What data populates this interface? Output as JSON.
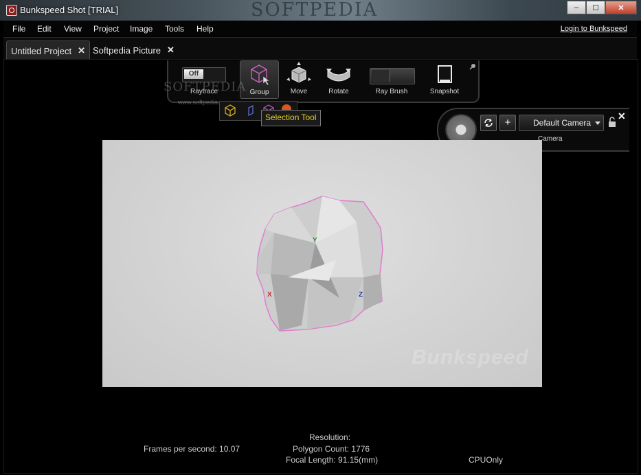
{
  "window": {
    "title": "Bunkspeed Shot [TRIAL]",
    "watermark": "SOFTPEDIA",
    "controls": {
      "minimize": "–",
      "maximize": "☐",
      "close": "✕"
    }
  },
  "menu": {
    "items": [
      "File",
      "Edit",
      "View",
      "Project",
      "Image",
      "Tools",
      "Help"
    ],
    "login_link": "Login to Bunkspeed"
  },
  "tabs": [
    {
      "label": "Untitled Project",
      "close": "✕",
      "active": true
    },
    {
      "label": "Softpedia Picture",
      "close": "✕",
      "active": false
    }
  ],
  "toolbar": {
    "raytrace": {
      "label": "Raytrace",
      "toggle": "Off"
    },
    "group": {
      "label": "Group"
    },
    "move": {
      "label": "Move"
    },
    "rotate": {
      "label": "Rotate"
    },
    "ray_brush": {
      "label": "Ray Brush"
    },
    "snapshot": {
      "label": "Snapshot"
    },
    "watermark": "SOFTPEDIA",
    "watermark_url": "www.softpedia.com"
  },
  "tooltip": "Selection Tool",
  "camera": {
    "selected": "Default Camera",
    "label": "Camera",
    "add": "+",
    "close": "✕"
  },
  "viewport": {
    "watermark": "Bunkspeed",
    "axis_x": "X",
    "axis_y": "Y",
    "axis_z": "Z",
    "selection_color": "#e080d0"
  },
  "status": {
    "fps": "Frames per second: 10.07",
    "resolution": "Resolution:",
    "polygon_count": "Polygon Count: 1776",
    "focal_length": "Focal Length: 91.15(mm)",
    "cpu": "CPUOnly"
  }
}
